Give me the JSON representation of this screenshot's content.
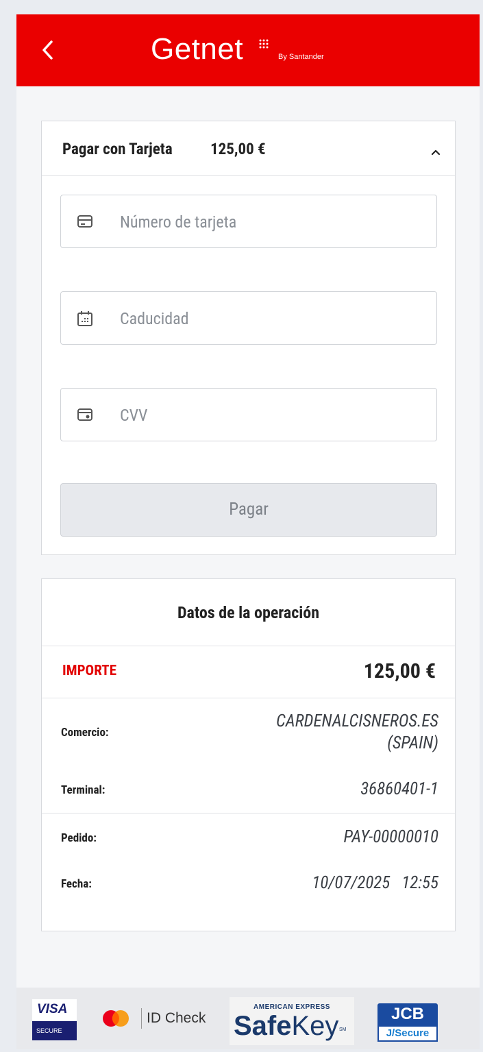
{
  "header": {
    "logo_text": "Getnet",
    "logo_by": "By Santander",
    "brand_color": "#ea0000"
  },
  "payment": {
    "title": "Pagar con Tarjeta",
    "amount": "125,00 €",
    "fields": {
      "card_number_placeholder": "Número de tarjeta",
      "expiry_placeholder": "Caducidad",
      "cvv_placeholder": "CVV"
    },
    "pay_button": "Pagar"
  },
  "operation": {
    "title": "Datos de la operación",
    "importe_label": "IMPORTE",
    "importe_value": "125,00 €",
    "comercio_label": "Comercio:",
    "comercio_value_line1": "CARDENALCISNEROS.ES",
    "comercio_value_line2": "(SPAIN)",
    "terminal_label": "Terminal:",
    "terminal_value": "36860401-1",
    "pedido_label": "Pedido:",
    "pedido_value": "PAY-00000010",
    "fecha_label": "Fecha:",
    "fecha_value": "10/07/2025   12:55"
  },
  "footer": {
    "visa_word": "VISA",
    "visa_secure": "SECURE",
    "mastercard_text": "ID Check",
    "amex_top": "AMERICAN EXPRESS",
    "amex_safe": "Safe",
    "amex_key": "Key",
    "amex_sm": "SM",
    "jcb_top": "JCB",
    "jcb_bottom": "J/Secure"
  }
}
